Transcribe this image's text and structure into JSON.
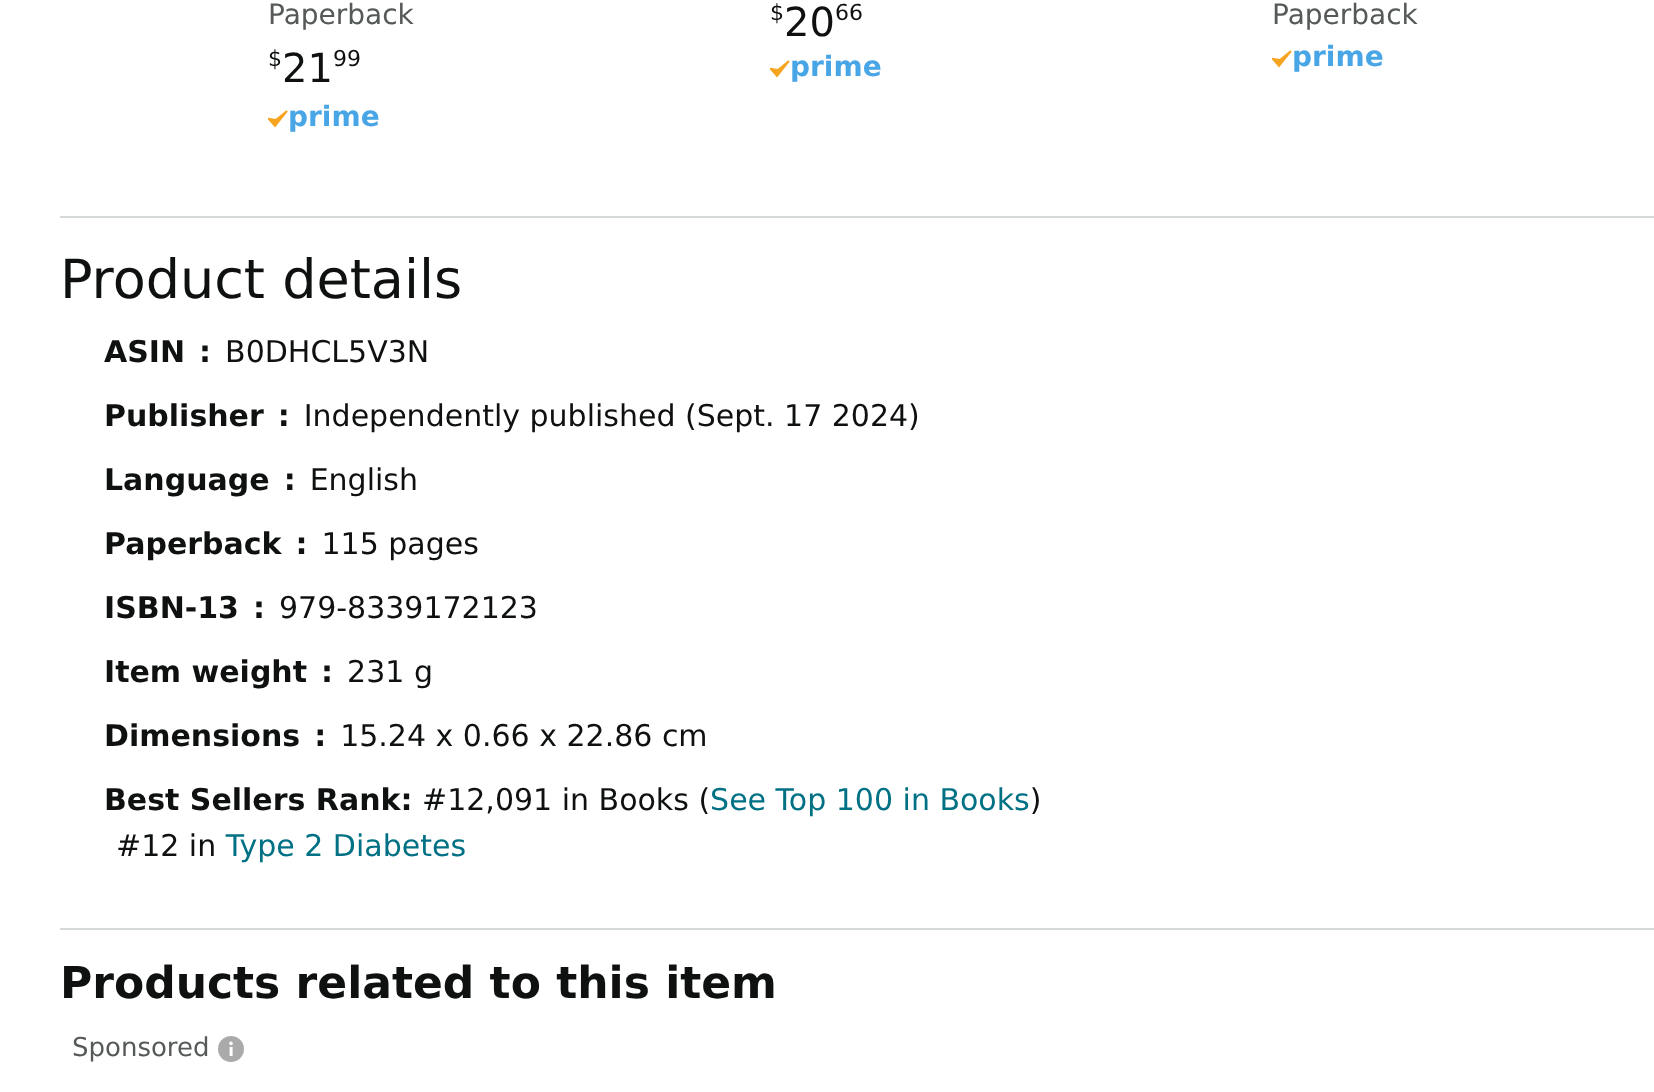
{
  "products": [
    {
      "format": "Paperback",
      "price": {
        "symbol": "$",
        "whole": "21",
        "fraction": "99"
      },
      "prime": "prime"
    },
    {
      "price": {
        "symbol": "$",
        "whole": "20",
        "fraction": "66"
      },
      "prime": "prime"
    },
    {
      "format": "Paperback",
      "prime": "prime"
    }
  ],
  "product_details": {
    "title": "Product details",
    "rows": [
      {
        "label": "ASIN",
        "separator": ":",
        "value": "B0DHCL5V3N"
      },
      {
        "label": "Publisher",
        "separator": ":",
        "value": "Independently published (Sept. 17 2024)"
      },
      {
        "label": "Language",
        "separator": ":",
        "value": "English"
      },
      {
        "label": "Paperback",
        "separator": ":",
        "value": "115 pages"
      },
      {
        "label": "ISBN-13",
        "separator": ":",
        "value": "979-8339172123"
      },
      {
        "label": "Item weight",
        "separator": ":",
        "value": "231 g"
      },
      {
        "label": "Dimensions",
        "separator": ":",
        "value": "15.24 x 0.66 x 22.86 cm"
      }
    ],
    "rank": {
      "label": "Best Sellers Rank:",
      "text": "#12,091 in Books (",
      "link": "See Top 100 in Books",
      "after": ")",
      "sub_text": "#12 in",
      "sub_link": "Type 2 Diabetes"
    }
  },
  "related": {
    "title": "Products related to this item",
    "sponsored": "Sponsored"
  }
}
